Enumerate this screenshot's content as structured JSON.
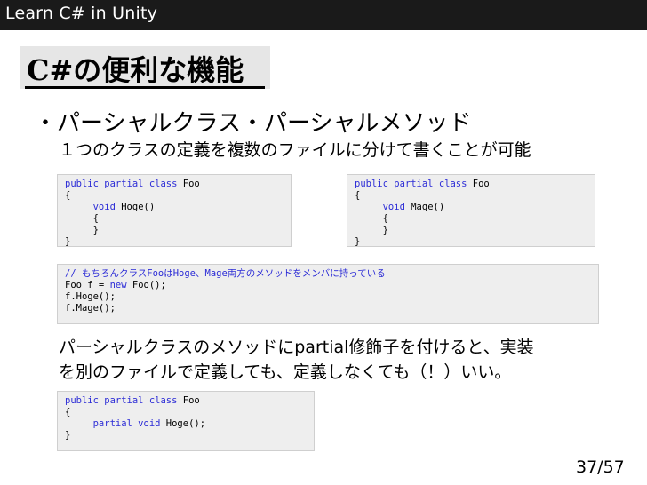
{
  "header": {
    "title": "Learn C# in Unity"
  },
  "slide": {
    "title": "C#の便利な機能",
    "bullet": "・パーシャルクラス・パーシャルメソッド",
    "description1": "１つのクラスの定義を複数のファイルに分けて書くことが可能",
    "description2_line1": "パーシャルクラスのメソッドにpartial修飾子を付けると、実装",
    "description2_line2": "を別のファイルで定義しても、定義しなくても（！）いい。"
  },
  "code_box_1": {
    "l1_kw": "public partial class",
    "l1_name": " Foo",
    "l2": "{",
    "l3_kw": "void",
    "l3_name": " Hoge()",
    "l4": "{",
    "l5": "}",
    "l6": "}"
  },
  "code_box_2": {
    "l1_kw": "public partial class",
    "l1_name": " Foo",
    "l2": "{",
    "l3_kw": "void",
    "l3_name": " Mage()",
    "l4": "{",
    "l5": "}",
    "l6": "}"
  },
  "code_box_3": {
    "comment": "// もちろんクラスFooはHoge、Mage両方のメソッドをメンバに持っている",
    "l2_pre": "Foo f = ",
    "l2_kw": "new",
    "l2_post": " Foo();",
    "l3": "f.Hoge();",
    "l4": "f.Mage();"
  },
  "code_box_4": {
    "l1_kw": "public partial class",
    "l1_name": " Foo",
    "l2": "{",
    "l3_kw": "partial void",
    "l3_name": " Hoge();",
    "l4": "}"
  },
  "footer": {
    "page_number": "37/57"
  }
}
